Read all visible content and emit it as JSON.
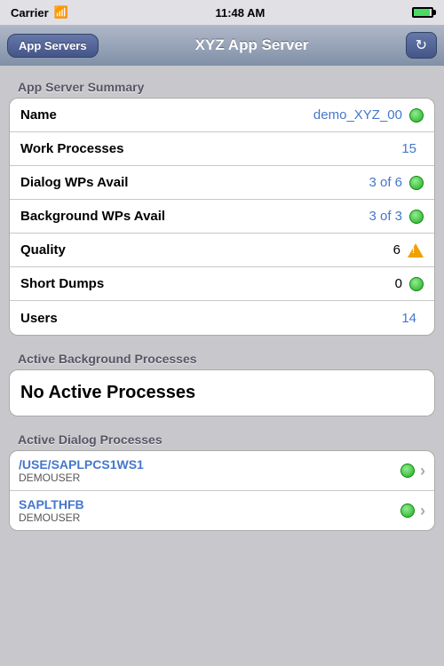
{
  "statusBar": {
    "carrier": "Carrier",
    "time": "11:48 AM"
  },
  "navBar": {
    "backLabel": "App Servers",
    "title": "XYZ App Server",
    "refreshIcon": "↻"
  },
  "summarySection": {
    "header": "App Server Summary",
    "rows": [
      {
        "label": "Name",
        "value": "demo_XYZ_00",
        "valueColor": "blue",
        "indicator": "green"
      },
      {
        "label": "Work Processes",
        "value": "15",
        "valueColor": "blue",
        "indicator": "none"
      },
      {
        "label": "Dialog WPs Avail",
        "value": "3 of 6",
        "valueColor": "blue",
        "indicator": "green"
      },
      {
        "label": "Background WPs Avail",
        "value": "3 of 3",
        "valueColor": "blue",
        "indicator": "green"
      },
      {
        "label": "Quality",
        "value": "6",
        "valueColor": "black",
        "indicator": "warning"
      },
      {
        "label": "Short Dumps",
        "value": "0",
        "valueColor": "black",
        "indicator": "green"
      },
      {
        "label": "Users",
        "value": "14",
        "valueColor": "blue",
        "indicator": "none"
      }
    ]
  },
  "backgroundSection": {
    "header": "Active Background Processes",
    "emptyLabel": "No Active Processes"
  },
  "dialogSection": {
    "header": "Active Dialog Processes",
    "processes": [
      {
        "name": "/USE/SAPLPCS1WS1",
        "user": "DEMOUSER",
        "indicator": "green"
      },
      {
        "name": "SAPLTHFB",
        "user": "DEMOUSER",
        "indicator": "green"
      }
    ]
  }
}
